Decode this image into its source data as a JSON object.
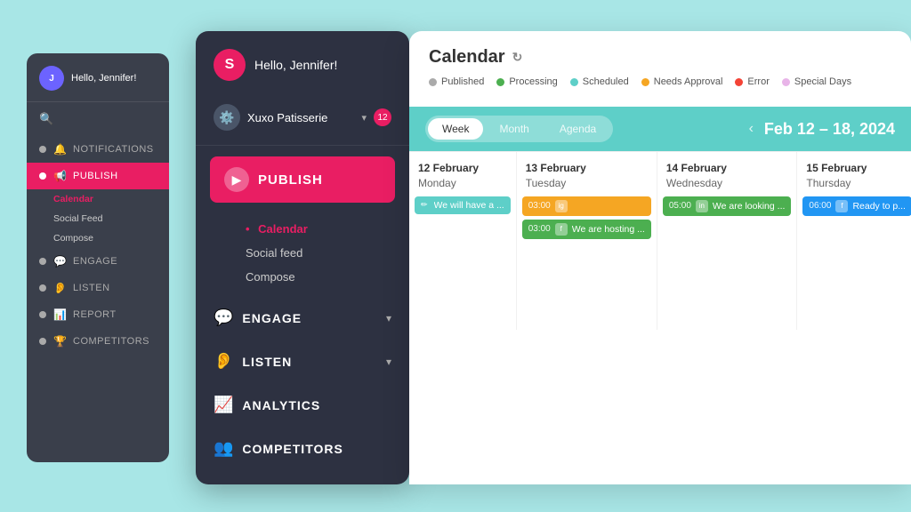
{
  "background": {
    "color": "#a8e6e6"
  },
  "small_sidebar": {
    "username": "Hello, Jennifer!",
    "nav_items": [
      {
        "id": "notifications",
        "label": "NOTIFICATIONS",
        "icon": "🔔"
      },
      {
        "id": "publish",
        "label": "PUBLISH",
        "active": true,
        "icon": "📢"
      },
      {
        "id": "engage",
        "label": "ENGAGE",
        "icon": "💬"
      },
      {
        "id": "listen",
        "label": "LISTEN",
        "icon": "👂"
      },
      {
        "id": "report",
        "label": "REPORT",
        "icon": "📊"
      },
      {
        "id": "competitors",
        "label": "COMPETITORS",
        "icon": "🏆"
      }
    ],
    "sub_items": [
      {
        "id": "calendar",
        "label": "Calendar",
        "active": true
      },
      {
        "id": "social-feed",
        "label": "Social Feed"
      },
      {
        "id": "compose",
        "label": "Compose"
      }
    ]
  },
  "main_sidebar": {
    "greeting": "Hello, Jennifer!",
    "org_name": "Xuxo Patisserie",
    "notification_count": "12",
    "publish_label": "PUBLISH",
    "sub_items": [
      {
        "id": "calendar",
        "label": "Calendar",
        "active": true
      },
      {
        "id": "social-feed",
        "label": "Social feed"
      },
      {
        "id": "compose",
        "label": "Compose"
      }
    ],
    "sections": [
      {
        "id": "engage",
        "label": "ENGAGE",
        "has_chevron": true
      },
      {
        "id": "listen",
        "label": "LISTEN",
        "has_chevron": true
      },
      {
        "id": "analytics",
        "label": "ANALYTICS",
        "has_chevron": false
      },
      {
        "id": "competitors",
        "label": "COMPETITORS",
        "has_chevron": false
      }
    ]
  },
  "calendar": {
    "title": "Calendar",
    "legend": [
      {
        "id": "published",
        "label": "Published",
        "color": "#aaa"
      },
      {
        "id": "processing",
        "label": "Processing",
        "color": "#4caf50"
      },
      {
        "id": "scheduled",
        "label": "Scheduled",
        "color": "#5ecfc8"
      },
      {
        "id": "needs-approval",
        "label": "Needs Approval",
        "color": "#f5a623"
      },
      {
        "id": "error",
        "label": "Error",
        "color": "#f44336"
      },
      {
        "id": "special-days",
        "label": "Special Days",
        "color": "#e8b4e8"
      }
    ],
    "tabs": [
      {
        "id": "week",
        "label": "Week",
        "active": true
      },
      {
        "id": "month",
        "label": "Month",
        "active": false
      },
      {
        "id": "agenda",
        "label": "Agenda",
        "active": false
      }
    ],
    "date_range": "Feb 12 – 18, 2024",
    "days": [
      {
        "date": "12 February",
        "day_name": "Monday",
        "events": [
          {
            "type": "teal",
            "text": "We will have a ...",
            "has_pencil": true
          }
        ]
      },
      {
        "date": "13 February",
        "day_name": "Tuesday",
        "events": [
          {
            "type": "yellow",
            "time": "03:00",
            "icon": "ig",
            "text": ""
          },
          {
            "type": "green",
            "time": "03:00",
            "icon": "f",
            "text": "We are hosting ..."
          }
        ]
      },
      {
        "date": "14 February",
        "day_name": "Wednesday",
        "events": [
          {
            "type": "green",
            "time": "05:00",
            "icon": "in",
            "text": "We are looking ..."
          }
        ]
      },
      {
        "date": "15 February",
        "day_name": "Thursday",
        "events": [
          {
            "type": "blue-event",
            "time": "06:00",
            "icon": "f",
            "text": "Ready to p..."
          }
        ]
      }
    ]
  }
}
